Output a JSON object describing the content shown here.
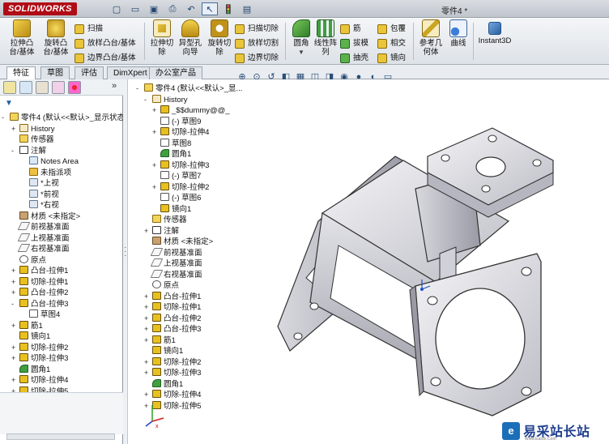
{
  "app": {
    "brand": "SOLIDWORKS",
    "document_title": "零件4 *"
  },
  "colors": {
    "brand_red": "#b00c16",
    "accent_blue": "#1f3f8f",
    "feature_yellow": "#e8c020",
    "feature_green": "#3f9f3f"
  },
  "quick_access": [
    {
      "icon": "new-doc-icon",
      "glyph": "▢"
    },
    {
      "icon": "open-folder-icon",
      "glyph": "▭"
    },
    {
      "icon": "save-icon",
      "glyph": "▣"
    },
    {
      "icon": "print-icon",
      "glyph": "⎙"
    },
    {
      "icon": "undo-icon",
      "glyph": "↶"
    },
    {
      "icon": "select-cursor-icon",
      "glyph": "↖"
    },
    {
      "icon": "rebuild-icon",
      "glyph": "🚦"
    },
    {
      "icon": "options-icon",
      "glyph": "▤"
    }
  ],
  "ribbon": {
    "extrude_boss": "拉伸凸\n台/基体",
    "revolve_boss": "旋转凸\n台/基体",
    "sweep": "扫描",
    "loft_boss": "放样凸台/基体",
    "boundary_boss": "边界凸台/基体",
    "extrude_cut": "拉伸切\n除",
    "hole_wizard": "异型孔\n向导",
    "revolve_cut": "旋转切\n除",
    "swept_cut": "扫描切除",
    "lofted_cut": "放样切割",
    "boundary_cut": "边界切除",
    "fillet": "圆角",
    "linear_pattern": "线性阵\n列",
    "rib": "筋",
    "draft": "拔模",
    "shell": "抽壳",
    "wrap": "包覆",
    "intersect": "相交",
    "mirror": "镜向",
    "reference_geometry": "参考几\n何体",
    "curves": "曲线",
    "instant3d": "Instant3D"
  },
  "tabs": [
    "特征",
    "草图",
    "评估",
    "DimXpert",
    "办公室产品"
  ],
  "left_panel": {
    "root": "零件4 (默认<<默认>_显示状态",
    "items": [
      {
        "label": "History",
        "level": 1,
        "icon": "history",
        "expand": "+"
      },
      {
        "label": "传感器",
        "level": 1,
        "icon": "sensor",
        "expand": ""
      },
      {
        "label": "注解",
        "level": 1,
        "icon": "annotation",
        "expand": "-"
      },
      {
        "label": "Notes Area",
        "level": 2,
        "icon": "notes",
        "expand": ""
      },
      {
        "label": "未指派项",
        "level": 2,
        "icon": "unassigned",
        "expand": ""
      },
      {
        "label": "*上视",
        "level": 2,
        "icon": "view",
        "expand": ""
      },
      {
        "label": "*前视",
        "level": 2,
        "icon": "view",
        "expand": ""
      },
      {
        "label": "*右视",
        "level": 2,
        "icon": "view",
        "expand": ""
      },
      {
        "label": "材质 <未指定>",
        "level": 1,
        "icon": "material",
        "expand": ""
      },
      {
        "label": "前视基准面",
        "level": 1,
        "icon": "plane",
        "expand": ""
      },
      {
        "label": "上视基准面",
        "level": 1,
        "icon": "plane",
        "expand": ""
      },
      {
        "label": "右视基准面",
        "level": 1,
        "icon": "plane",
        "expand": ""
      },
      {
        "label": "原点",
        "level": 1,
        "icon": "origin",
        "expand": ""
      },
      {
        "label": "凸台-拉伸1",
        "level": 1,
        "icon": "feature",
        "expand": "+"
      },
      {
        "label": "切除-拉伸1",
        "level": 1,
        "icon": "feature",
        "expand": "+"
      },
      {
        "label": "凸台-拉伸2",
        "level": 1,
        "icon": "feature",
        "expand": "+"
      },
      {
        "label": "凸台-拉伸3",
        "level": 1,
        "icon": "feature",
        "expand": "-"
      },
      {
        "label": "草图4",
        "level": 2,
        "icon": "sketch",
        "expand": ""
      },
      {
        "label": "筋1",
        "level": 1,
        "icon": "feature",
        "expand": "+"
      },
      {
        "label": "镜向1",
        "level": 1,
        "icon": "feature",
        "expand": ""
      },
      {
        "label": "切除-拉伸2",
        "level": 1,
        "icon": "feature",
        "expand": "+"
      },
      {
        "label": "切除-拉伸3",
        "level": 1,
        "icon": "feature",
        "expand": "+"
      },
      {
        "label": "圆角1",
        "level": 1,
        "icon": "fillet",
        "expand": ""
      },
      {
        "label": "切除-拉伸4",
        "level": 1,
        "icon": "feature",
        "expand": "+"
      },
      {
        "label": "切除-拉伸5",
        "level": 1,
        "icon": "feature",
        "expand": "+"
      }
    ]
  },
  "flyout_tree": {
    "root": "零件4 (默认<<默认>_显...",
    "items": [
      {
        "label": "History",
        "level": 1,
        "icon": "history",
        "expand": "-"
      },
      {
        "label": "_$$dummy@@_",
        "level": 2,
        "icon": "feature",
        "expand": "+"
      },
      {
        "label": "(-) 草图9",
        "level": 2,
        "icon": "sketch",
        "expand": ""
      },
      {
        "label": "切除-拉伸4",
        "level": 2,
        "icon": "feature",
        "expand": "+"
      },
      {
        "label": "草图8",
        "level": 2,
        "icon": "sketch",
        "expand": ""
      },
      {
        "label": "圆角1",
        "level": 2,
        "icon": "fillet",
        "expand": ""
      },
      {
        "label": "切除-拉伸3",
        "level": 2,
        "icon": "feature",
        "expand": "+"
      },
      {
        "label": "(-) 草图7",
        "level": 2,
        "icon": "sketch",
        "expand": ""
      },
      {
        "label": "切除-拉伸2",
        "level": 2,
        "icon": "feature",
        "expand": "+"
      },
      {
        "label": "(-) 草图6",
        "level": 2,
        "icon": "sketch",
        "expand": ""
      },
      {
        "label": "镜向1",
        "level": 2,
        "icon": "feature",
        "expand": ""
      },
      {
        "label": "传感器",
        "level": 1,
        "icon": "sensor",
        "expand": ""
      },
      {
        "label": "注解",
        "level": 1,
        "icon": "annotation",
        "expand": "+"
      },
      {
        "label": "材质 <未指定>",
        "level": 1,
        "icon": "material",
        "expand": ""
      },
      {
        "label": "前视基准面",
        "level": 1,
        "icon": "plane",
        "expand": ""
      },
      {
        "label": "上视基准面",
        "level": 1,
        "icon": "plane",
        "expand": ""
      },
      {
        "label": "右视基准面",
        "level": 1,
        "icon": "plane",
        "expand": ""
      },
      {
        "label": "原点",
        "level": 1,
        "icon": "origin",
        "expand": ""
      },
      {
        "label": "凸台-拉伸1",
        "level": 1,
        "icon": "feature",
        "expand": "+"
      },
      {
        "label": "切除-拉伸1",
        "level": 1,
        "icon": "feature",
        "expand": "+"
      },
      {
        "label": "凸台-拉伸2",
        "level": 1,
        "icon": "feature",
        "expand": "+"
      },
      {
        "label": "凸台-拉伸3",
        "level": 1,
        "icon": "feature",
        "expand": "+"
      },
      {
        "label": "筋1",
        "level": 1,
        "icon": "feature",
        "expand": "+"
      },
      {
        "label": "镜向1",
        "level": 1,
        "icon": "feature",
        "expand": ""
      },
      {
        "label": "切除-拉伸2",
        "level": 1,
        "icon": "feature",
        "expand": "+"
      },
      {
        "label": "切除-拉伸3",
        "level": 1,
        "icon": "feature",
        "expand": "+"
      },
      {
        "label": "圆角1",
        "level": 1,
        "icon": "fillet",
        "expand": ""
      },
      {
        "label": "切除-拉伸4",
        "level": 1,
        "icon": "feature",
        "expand": "+"
      },
      {
        "label": "切除-拉伸5",
        "level": 1,
        "icon": "feature",
        "expand": "+"
      }
    ]
  },
  "watermark": {
    "logo": "e",
    "text": "易采站长站",
    "url": "Www.Easck.Com"
  }
}
